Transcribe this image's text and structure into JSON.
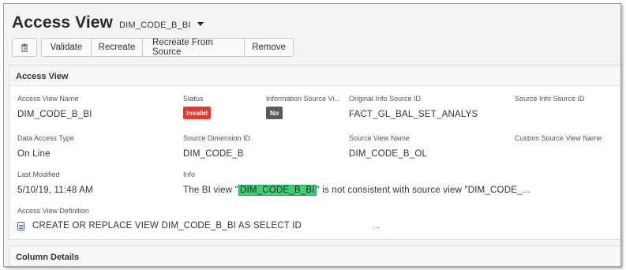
{
  "header": {
    "title": "Access View",
    "subtitle": "DIM_CODE_B_BI"
  },
  "toolbar": {
    "delete_icon": "trash-icon",
    "buttons": [
      "Validate",
      "Recreate",
      "Recreate From Source",
      "Remove"
    ]
  },
  "access_view_section": {
    "title": "Access View",
    "fields": {
      "access_view_name": {
        "label": "Access View Name",
        "value": "DIM_CODE_B_BI"
      },
      "status": {
        "label": "Status",
        "value": "Invalid"
      },
      "information_source": {
        "label": "Information Source Vi...",
        "value": "No"
      },
      "original_info_source_id": {
        "label": "Original Info Source ID",
        "value": "FACT_GL_BAL_SET_ANALYS"
      },
      "source_info_source_id": {
        "label": "Source Info Source ID",
        "value": ""
      },
      "data_access_type": {
        "label": "Data Access Type",
        "value": "On Line"
      },
      "source_dimension_id": {
        "label": "Source Dimension ID",
        "value": "DIM_CODE_B"
      },
      "source_view_name": {
        "label": "Source View Name",
        "value": "DIM_CODE_B_OL"
      },
      "custom_source_view_name": {
        "label": "Custom Source View Name",
        "value": ""
      },
      "last_modified": {
        "label": "Last Modified",
        "value": "5/10/19, 11:48 AM"
      },
      "info": {
        "label": "Info",
        "prefix": "The BI view \"",
        "highlight": "DIM_CODE_B_BI",
        "suffix": "\" is not consistent with source view \"DIM_CODE_..."
      },
      "access_view_definition": {
        "label": "Access View Definition",
        "value": "CREATE OR REPLACE VIEW DIM_CODE_B_BI AS SELECT ID",
        "ellipsis": "..."
      }
    }
  },
  "column_details_section": {
    "title": "Column Details"
  },
  "colors": {
    "invalid_badge": "#e03b2d",
    "no_badge": "#5a5a5a",
    "highlight": "#3fcf7a",
    "doc_icon": "#3b6bb0"
  }
}
